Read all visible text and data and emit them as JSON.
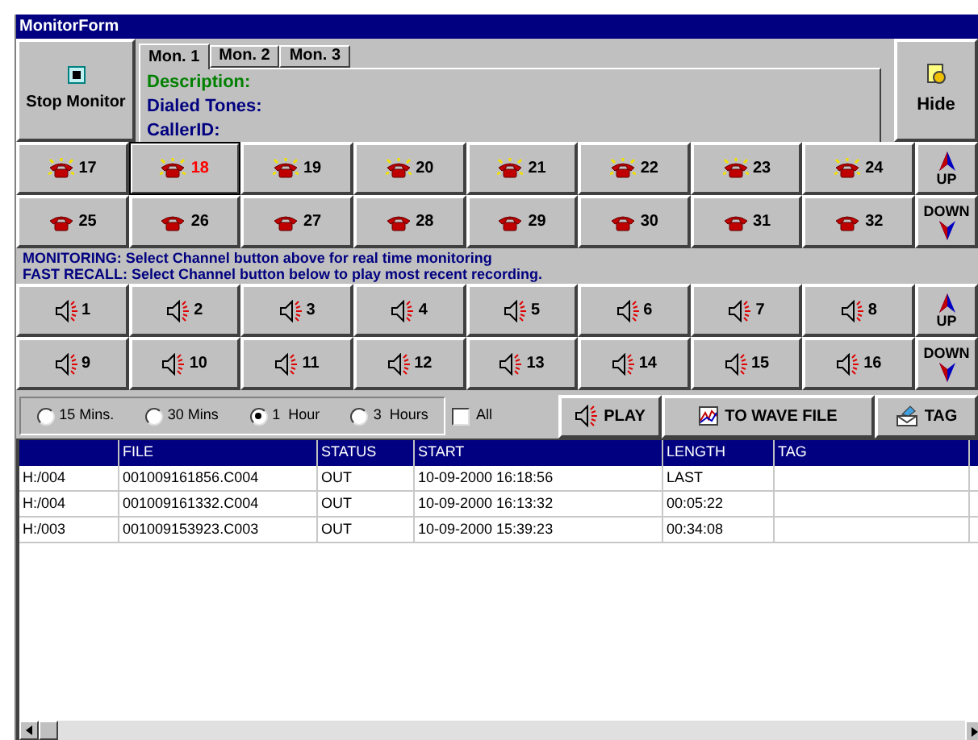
{
  "window": {
    "title": "MonitorForm"
  },
  "stop_button": {
    "label": "Stop Monitor"
  },
  "monitor_tabs": [
    {
      "label": "Mon. 1",
      "selected": true
    },
    {
      "label": "Mon. 2",
      "selected": false
    },
    {
      "label": "Mon. 3",
      "selected": false
    }
  ],
  "info_fields": [
    {
      "label": "Description:",
      "color": "#008000"
    },
    {
      "label": "Dialed Tones:",
      "color": "#000080"
    },
    {
      "label": "CallerID:",
      "color": "#000080"
    }
  ],
  "hide_button": {
    "label": "Hide"
  },
  "channels": [
    {
      "label": "17",
      "ringing": true,
      "selected": false
    },
    {
      "label": "18",
      "ringing": true,
      "selected": true
    },
    {
      "label": "19",
      "ringing": true,
      "selected": false
    },
    {
      "label": "20",
      "ringing": true,
      "selected": false
    },
    {
      "label": "21",
      "ringing": true,
      "selected": false
    },
    {
      "label": "22",
      "ringing": true,
      "selected": false
    },
    {
      "label": "23",
      "ringing": true,
      "selected": false
    },
    {
      "label": "24",
      "ringing": true,
      "selected": false
    },
    {
      "label": "25",
      "ringing": false,
      "selected": false
    },
    {
      "label": "26",
      "ringing": false,
      "selected": false
    },
    {
      "label": "27",
      "ringing": false,
      "selected": false
    },
    {
      "label": "28",
      "ringing": false,
      "selected": false
    },
    {
      "label": "29",
      "ringing": false,
      "selected": false
    },
    {
      "label": "30",
      "ringing": false,
      "selected": false
    },
    {
      "label": "31",
      "ringing": false,
      "selected": false
    },
    {
      "label": "32",
      "ringing": false,
      "selected": false
    }
  ],
  "channel_nav": [
    {
      "label": "UP",
      "kind": "up"
    },
    {
      "label": "DOWN",
      "kind": "down"
    }
  ],
  "instructions": [
    "MONITORING: Select Channel button above for real time monitoring",
    "FAST RECALL: Select Channel button below to play most recent recording."
  ],
  "recall_channels": [
    {
      "label": "1"
    },
    {
      "label": "2"
    },
    {
      "label": "3"
    },
    {
      "label": "4"
    },
    {
      "label": "5"
    },
    {
      "label": "6"
    },
    {
      "label": "7"
    },
    {
      "label": "8"
    },
    {
      "label": "9"
    },
    {
      "label": "10"
    },
    {
      "label": "11"
    },
    {
      "label": "12"
    },
    {
      "label": "13"
    },
    {
      "label": "14"
    },
    {
      "label": "15"
    },
    {
      "label": "16"
    }
  ],
  "recall_nav": [
    {
      "label": "UP",
      "kind": "up"
    },
    {
      "label": "DOWN",
      "kind": "down"
    }
  ],
  "time_range": [
    {
      "label": "15 Mins.",
      "selected": false
    },
    {
      "label": "30 Mins",
      "selected": false
    },
    {
      "label": "1  Hour",
      "selected": true
    },
    {
      "label": "3  Hours",
      "selected": false
    }
  ],
  "all_checkbox": {
    "label": "All",
    "checked": false
  },
  "actions": [
    {
      "label": "PLAY",
      "kind": "play"
    },
    {
      "label": "TO WAVE FILE",
      "kind": "wave"
    },
    {
      "label": "TAG",
      "kind": "tag"
    }
  ],
  "table": {
    "columns": [
      "FILE",
      "STATUS",
      "START",
      "LENGTH",
      "TAG"
    ],
    "rows": [
      {
        "column_1": "H:/004",
        "file": "001009161856.C004",
        "status": "OUT",
        "start": "10-09-2000 16:18:56",
        "length": "LAST"
      },
      {
        "column_1": "H:/004",
        "file": "001009161332.C004",
        "status": "OUT",
        "start": "10-09-2000 16:13:32",
        "length": "00:05:22"
      },
      {
        "column_1": "H:/003",
        "file": "001009153923.C003",
        "status": "OUT",
        "start": "10-09-2000 15:39:23",
        "length": "00:34:08"
      }
    ]
  }
}
